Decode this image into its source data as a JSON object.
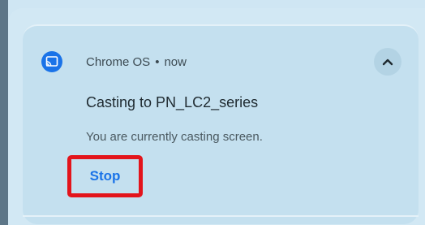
{
  "notification": {
    "app_name": "Chrome OS",
    "separator": "•",
    "timestamp": "now",
    "title": "Casting to PN_LC2_series",
    "message": "You are currently casting screen.",
    "action_label": "Stop",
    "app_icon": "cast-icon",
    "collapse_icon": "chevron-up-icon"
  },
  "colors": {
    "accent": "#1a73e8",
    "highlight_border": "#e3141b",
    "card_background": "#c4e0ef"
  }
}
